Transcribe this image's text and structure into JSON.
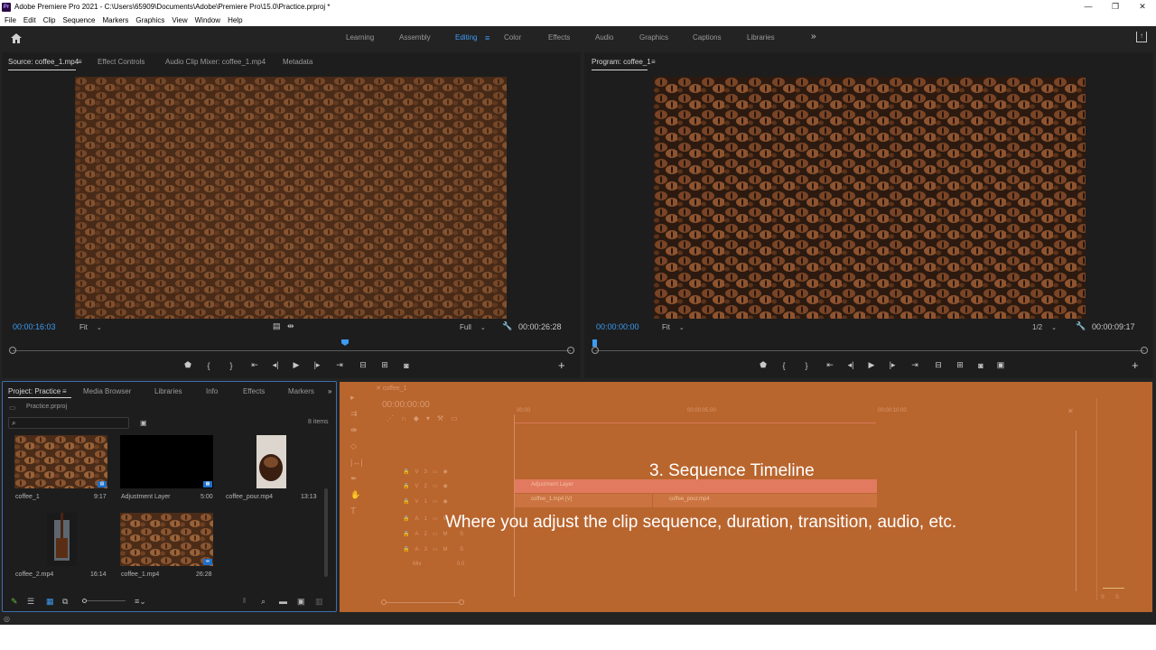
{
  "titlebar": {
    "logo": "Pr",
    "title": "Adobe Premiere Pro 2021 - C:\\Users\\65909\\Documents\\Adobe\\Premiere Pro\\15.0\\Practice.prproj *",
    "minimize": "—",
    "restore": "❐",
    "close": "✕"
  },
  "menu": [
    "File",
    "Edit",
    "Clip",
    "Sequence",
    "Markers",
    "Graphics",
    "View",
    "Window",
    "Help"
  ],
  "workspaces": {
    "tabs": [
      "Learning",
      "Assembly",
      "Editing",
      "Color",
      "Effects",
      "Audio",
      "Graphics",
      "Captions",
      "Libraries"
    ],
    "active": "Editing",
    "more": "»"
  },
  "source_panel": {
    "tabs": [
      "Source: coffee_1.mp4",
      "Effect Controls",
      "Audio Clip Mixer: coffee_1.mp4",
      "Metadata"
    ],
    "menu_icon": "≡",
    "timecode": "00:00:16:03",
    "fit": "Fit",
    "quality": "Full",
    "duration": "00:00:26:28"
  },
  "program_panel": {
    "tab": "Program: coffee_1",
    "menu_icon": "≡",
    "timecode": "00:00:00:00",
    "fit": "Fit",
    "quality": "1/2",
    "duration": "00:00:09:17"
  },
  "project_panel": {
    "tabs": [
      "Project: Practice",
      "Media Browser",
      "Libraries",
      "Info",
      "Effects",
      "Markers"
    ],
    "more": "»",
    "file": "Practice.prproj",
    "items_count": "8 items",
    "items": [
      {
        "name": "coffee_1",
        "duration": "9:17"
      },
      {
        "name": "Adjustment Layer",
        "duration": "5:00"
      },
      {
        "name": "coffee_pour.mp4",
        "duration": "13:13"
      },
      {
        "name": "coffee_2.mp4",
        "duration": "16:14"
      },
      {
        "name": "coffee_1.mp4",
        "duration": "26:28"
      }
    ]
  },
  "timeline": {
    "sequence_tab": "coffee_1",
    "timecode": "00:00:00:00",
    "ruler": [
      "00:00",
      "00:00:05:00",
      "00:00:10:00"
    ],
    "tracks": [
      "V3",
      "V2",
      "V1",
      "A1",
      "A2",
      "A3",
      "Mix"
    ],
    "mix_value": "0.0",
    "clips": [
      "Adjustment Layer",
      "coffee_1.mp4 [V]",
      "coffee_pour.mp4"
    ],
    "overlay_title": "3. Sequence Timeline",
    "overlay_desc": "Where you adjust the clip sequence, duration, transition, audio, etc.",
    "meter_labels": [
      "S",
      "S"
    ]
  },
  "colors": {
    "accent_blue": "#3d9bf2",
    "timeline_highlight": "#b9652e",
    "panel_bg": "#1d1d1d"
  }
}
